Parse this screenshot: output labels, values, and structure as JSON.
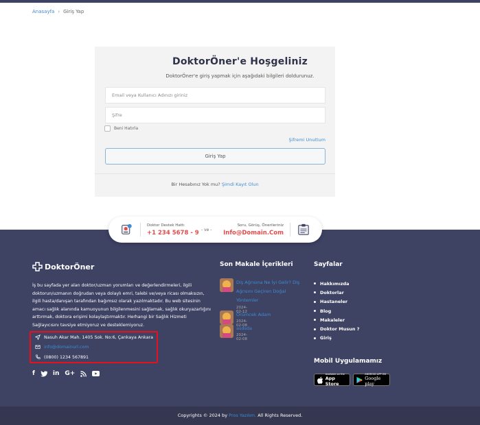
{
  "breadcrumb": {
    "home": "Anasayfa",
    "separator": "›",
    "current": "Giriş Yap"
  },
  "login": {
    "title": "DoktorÖner'e Hoşgeliniz",
    "subtitle": "DoktorÖner'e giriş yapmak için aşağıdaki bilgileri doldurunuz.",
    "email_placeholder": "Email veya Kullanıcı Adınızı giriniz",
    "password_placeholder": "Şifre",
    "remember_label": "Beni Hatırla",
    "forgot_label": "Şifremi Unuttum",
    "submit_label": "Giriş Yap",
    "register_text": "Bir Hesabınız Yok mu?",
    "register_link": "Şimdi Kayıt Olun"
  },
  "contact_strip": {
    "left_label": "Doktor Destek Hattı",
    "left_value": "+1 234 5678 - 9",
    "middle": "- ve -",
    "right_label": "Soru, Görüş, Önerileriniz",
    "right_value": "Info@Domain.Com"
  },
  "footer": {
    "logo_text": "DoktorÖner",
    "about": "İş bu sayfada yer alan doktor/uzman yorumları ve değerlendirmeleri, ilgili doktorun/uzmanın doğrudan veya dolaylı emri, talebi ve/veya ricası olmaksızın, ilgili hasta/danışan tarafından bağımsız olarak yazılmaktadır. Bu web sitesinin amacı sağlık alanında kamuoyunun bilgilenmesini sağlamak, sağlık okuryazarlığını arttırmak, doktora erişimi kolaylaştırmaktır. Herhangi bir Sağlık Hizmeti Sağlayıcısını tavsiye etmiyoruz ve desteklemiyoruz.",
    "address": "Nasuh Akar Mah. 1405 Sok. No:6, Çankaya Ankara",
    "email": "info@domainurl.com",
    "phone": "(0800) 1234 567891",
    "social": [
      "f",
      "t",
      "in",
      "G+",
      "rss",
      "yt"
    ],
    "articles_title": "Son Makale İçerikleri",
    "articles": [
      {
        "title": "Diş Ağrısına Ne İyi Gelir? Diş Ağrısını Geçiren Doğal Yöntemler",
        "date": "2024-02-12"
      },
      {
        "title": "Örümcek Adam",
        "date": "2024-02-08"
      },
      {
        "title": "asdsda",
        "date": "2024-02-08"
      }
    ],
    "pages_title": "Sayfalar",
    "pages": [
      "Hakkımızda",
      "Doktorlar",
      "Hastaneler",
      "Blog",
      "Makaleler",
      "Doktor Musun ?",
      "Giriş"
    ],
    "mobile_title": "Mobil Uygulamamız",
    "appstore_small": "Available on the",
    "appstore_big": "App Store",
    "googleplay_small": "ANDROID APP ON",
    "googleplay_big": "Google play"
  },
  "copyright": {
    "prefix": "Copyrights © 2024 by",
    "company": "Pros Yazılım.",
    "suffix": "All Rights Reserved."
  }
}
